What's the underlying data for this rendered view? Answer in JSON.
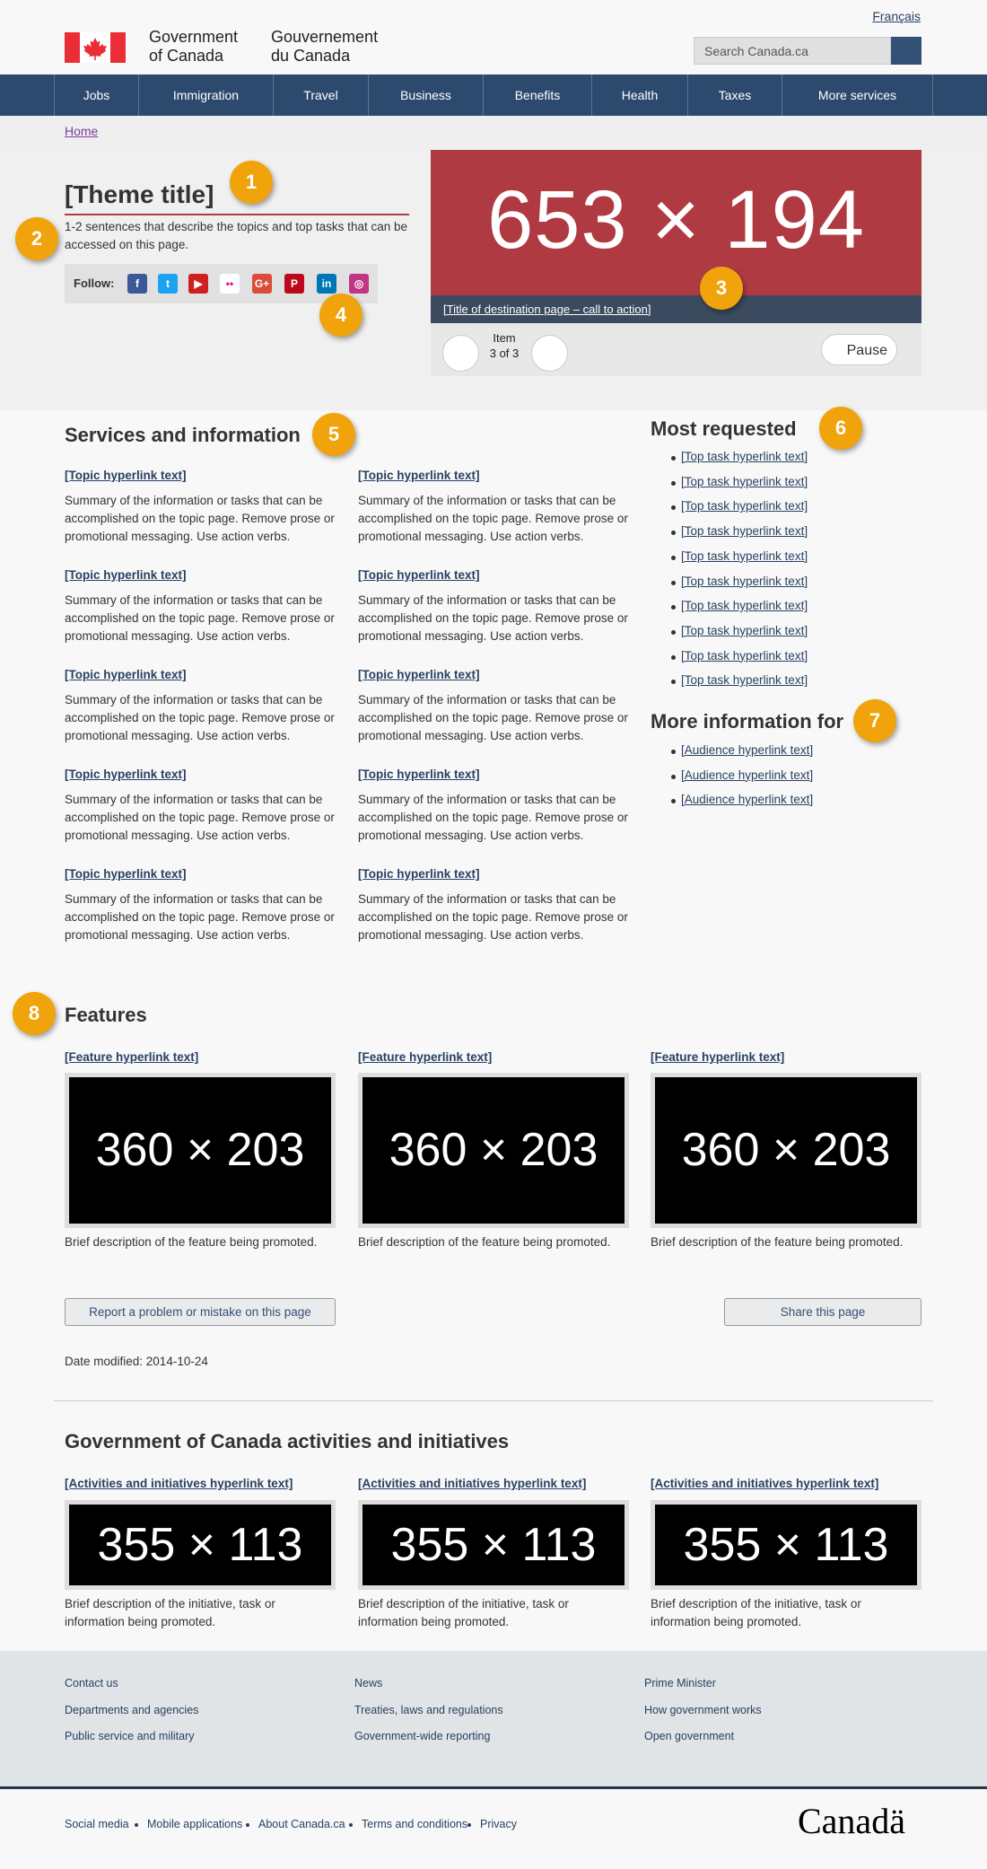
{
  "header": {
    "lang_toggle": "Français",
    "gov_en_line1": "Government",
    "gov_en_line2": "of Canada",
    "gov_fr_line1": "Gouvernement",
    "gov_fr_line2": "du Canada",
    "search_placeholder": "Search Canada.ca"
  },
  "nav": {
    "items": [
      "Jobs",
      "Immigration",
      "Travel",
      "Business",
      "Benefits",
      "Health",
      "Taxes",
      "More services"
    ]
  },
  "breadcrumb": {
    "home": "Home"
  },
  "intro": {
    "title": "[Theme title]",
    "description": "1-2 sentences that describe the topics and top tasks that can be accessed on this page.",
    "follow_label": "Follow:",
    "social": [
      {
        "name": "facebook-icon",
        "glyph": "f",
        "color": "#3b5998"
      },
      {
        "name": "twitter-icon",
        "glyph": "t",
        "color": "#1da1f2"
      },
      {
        "name": "youtube-icon",
        "glyph": "▶",
        "color": "#cd201f"
      },
      {
        "name": "flickr-icon",
        "glyph": "••",
        "color": "#ffffff"
      },
      {
        "name": "google-plus-icon",
        "glyph": "G+",
        "color": "#dd4b39"
      },
      {
        "name": "pinterest-icon",
        "glyph": "P",
        "color": "#bd081c"
      },
      {
        "name": "linkedin-icon",
        "glyph": "in",
        "color": "#0077b5"
      },
      {
        "name": "instagram-icon",
        "glyph": "◎",
        "color": "#c13584"
      }
    ]
  },
  "carousel": {
    "image_text": "653 × 194",
    "cta": "[Title of destination page – call to action]",
    "item_label": "Item",
    "item_count": "3 of 3",
    "pause": "Pause"
  },
  "badges": [
    "1",
    "2",
    "3",
    "4",
    "5",
    "6",
    "7",
    "8"
  ],
  "services": {
    "heading": "Services and information",
    "topic_link": "[Topic hyperlink text]",
    "topic_summary": "Summary of the information or tasks that can be accomplished on the topic page. Remove prose or promotional messaging. Use action verbs."
  },
  "most_requested": {
    "heading": "Most requested",
    "item": "[Top task hyperlink text]"
  },
  "more_info": {
    "heading": "More information for",
    "item": "[Audience hyperlink text]"
  },
  "features": {
    "heading": "Features",
    "link": "[Feature hyperlink text]",
    "image_text": "360 × 203",
    "description": "Brief description of the feature being promoted."
  },
  "page_actions": {
    "report": "Report a problem or mistake on this page",
    "share": "Share this page",
    "date_modified": "Date modified: 2014-10-24"
  },
  "activities": {
    "heading": "Government of Canada activities and initiatives",
    "link": "[Activities and initiatives hyperlink text]",
    "image_text": "355 × 113",
    "description_line1": "Brief description of the initiative, task or",
    "description_line2": "information being promoted."
  },
  "footer": {
    "col1": [
      "Contact us",
      "Departments and agencies",
      "Public service and military"
    ],
    "col2": [
      "News",
      "Treaties, laws and regulations",
      "Government-wide reporting"
    ],
    "col3": [
      "Prime Minister",
      "How government works",
      "Open government"
    ],
    "bottom": [
      "Social media",
      "Mobile applications",
      "About Canada.ca",
      "Terms and conditions",
      "Privacy"
    ],
    "wordmark": "Canadä"
  },
  "colors": {
    "nav": "#2c4a6e",
    "accent_red": "#af3c43",
    "link": "#284162",
    "badge": "#f0a30a"
  }
}
